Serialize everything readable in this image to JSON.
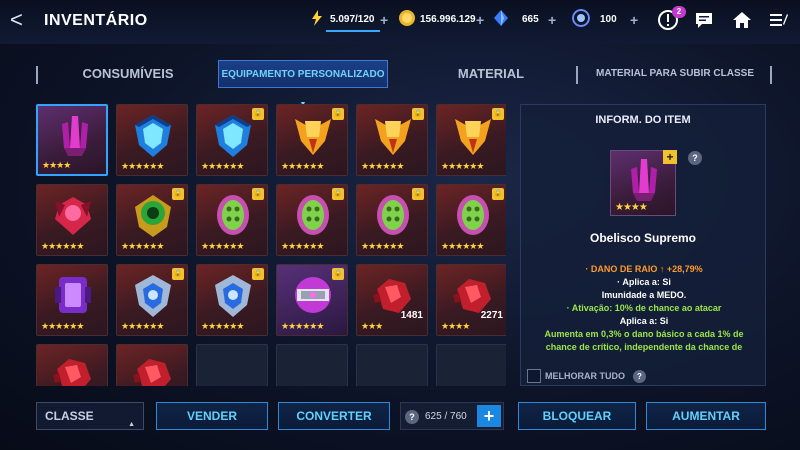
{
  "header": {
    "title": "INVENTÁRIO",
    "energy": "5.097/120",
    "gold": "156.996.129",
    "crystals": "665",
    "orbs": "100",
    "notification_count": "2"
  },
  "tabs": [
    {
      "label": "CONSUMÍVEIS",
      "active": false
    },
    {
      "label": "EQUIPAMENTO PERSONALIZADO",
      "active": true
    },
    {
      "label": "MATERIAL",
      "active": false
    },
    {
      "label": "MATERIAL PARA SUBIR CLASSE",
      "active": false
    }
  ],
  "grid": [
    {
      "kind": "obelisk",
      "stars": "★★★★",
      "locked": false,
      "selected": true,
      "qty": ""
    },
    {
      "kind": "shield-blue",
      "stars": "★★★★★★",
      "locked": false,
      "selected": false,
      "qty": ""
    },
    {
      "kind": "shield-blue",
      "stars": "★★★★★★",
      "locked": true,
      "selected": false,
      "qty": ""
    },
    {
      "kind": "gold-arrow",
      "stars": "★★★★★★",
      "locked": true,
      "selected": false,
      "qty": ""
    },
    {
      "kind": "gold-arrow",
      "stars": "★★★★★★",
      "locked": true,
      "selected": false,
      "qty": ""
    },
    {
      "kind": "gold-arrow",
      "stars": "★★★★★★",
      "locked": true,
      "selected": false,
      "qty": ""
    },
    {
      "kind": "red-wing",
      "stars": "★★★★★★",
      "locked": false,
      "selected": false,
      "qty": ""
    },
    {
      "kind": "green-eye",
      "stars": "★★★★★★",
      "locked": true,
      "selected": false,
      "qty": ""
    },
    {
      "kind": "green-pod",
      "stars": "★★★★★★",
      "locked": true,
      "selected": false,
      "qty": ""
    },
    {
      "kind": "green-pod",
      "stars": "★★★★★★",
      "locked": true,
      "selected": false,
      "qty": ""
    },
    {
      "kind": "green-pod",
      "stars": "★★★★★★",
      "locked": true,
      "selected": false,
      "qty": ""
    },
    {
      "kind": "green-pod",
      "stars": "★★★★★★",
      "locked": true,
      "selected": false,
      "qty": ""
    },
    {
      "kind": "purple-core",
      "stars": "★★★★★★",
      "locked": false,
      "selected": false,
      "qty": ""
    },
    {
      "kind": "silver-shield",
      "stars": "★★★★★★",
      "locked": true,
      "selected": false,
      "qty": ""
    },
    {
      "kind": "silver-shield",
      "stars": "★★★★★★",
      "locked": true,
      "selected": false,
      "qty": ""
    },
    {
      "kind": "purple-sphere",
      "stars": "★★★★★★",
      "locked": true,
      "selected": false,
      "qty": ""
    },
    {
      "kind": "red-ore",
      "stars": "★★★",
      "locked": false,
      "selected": false,
      "qty": "1481"
    },
    {
      "kind": "red-ore",
      "stars": "★★★★",
      "locked": false,
      "selected": false,
      "qty": "2271"
    },
    {
      "kind": "red-ore",
      "stars": "",
      "locked": false,
      "selected": false,
      "qty": ""
    },
    {
      "kind": "red-ore",
      "stars": "",
      "locked": false,
      "selected": false,
      "qty": ""
    },
    {
      "kind": "empty",
      "stars": "",
      "locked": false,
      "selected": false,
      "qty": ""
    },
    {
      "kind": "empty",
      "stars": "",
      "locked": false,
      "selected": false,
      "qty": ""
    },
    {
      "kind": "empty",
      "stars": "",
      "locked": false,
      "selected": false,
      "qty": ""
    },
    {
      "kind": "empty",
      "stars": "",
      "locked": false,
      "selected": false,
      "qty": ""
    }
  ],
  "info": {
    "title": "INFORM. DO ITEM",
    "item_stars": "★★★★",
    "item_name": "Obelisco Supremo",
    "stat_main": "· DANO DE RAIO ↑ +28,79%",
    "line_applies1": "· Aplica a: Si",
    "line_immunity": "Imunidade a MEDO.",
    "line_activation": "· Ativação: 10% de chance ao atacar",
    "line_applies2": "Aplica a: Si",
    "line_desc1": "Aumenta em 0,3% o dano básico a cada 1% de",
    "line_desc2": "chance de crítico, independente da chance de",
    "improve_all": "MELHORAR TUDO"
  },
  "bottom": {
    "class_label": "CLASSE",
    "sell": "VENDER",
    "convert": "CONVERTER",
    "capacity": "625 / 760",
    "lock": "BLOQUEAR",
    "increase": "AUMENTAR"
  }
}
